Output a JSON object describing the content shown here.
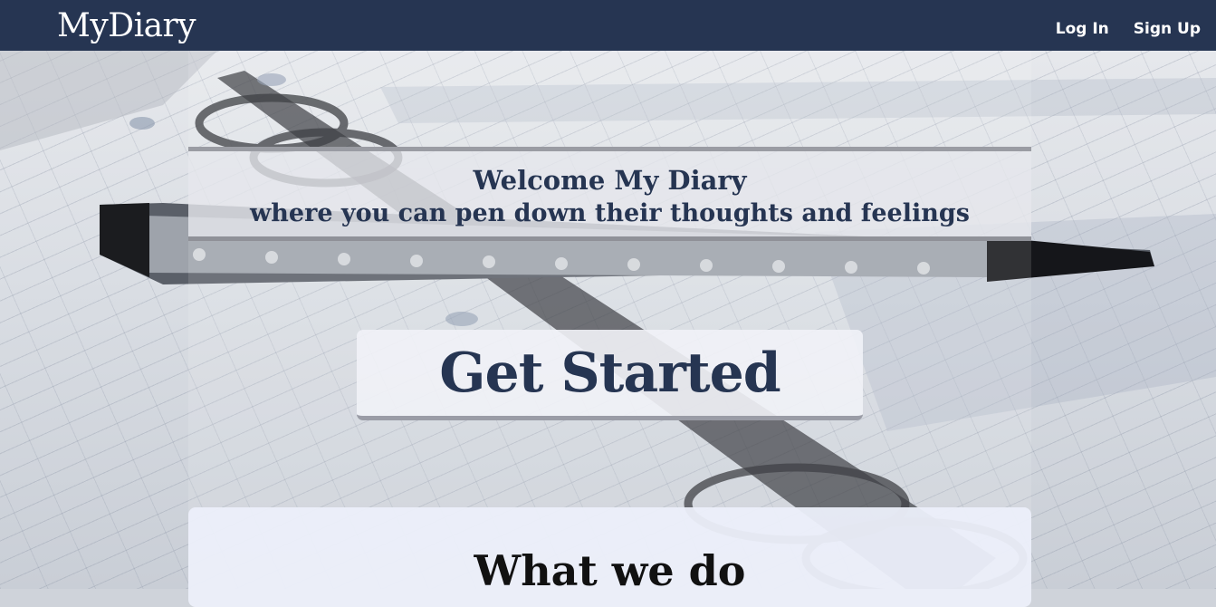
{
  "navbar": {
    "brand": "MyDiary",
    "links": [
      {
        "label": "Log In"
      },
      {
        "label": "Sign Up"
      }
    ]
  },
  "hero": {
    "title": "Welcome My Diary",
    "subtitle": "where you can pen down their thoughts and feelings",
    "cta_label": "Get Started"
  },
  "about": {
    "heading": "What we do"
  },
  "colors": {
    "navbar_bg": "#263552",
    "accent_text": "#263552"
  }
}
